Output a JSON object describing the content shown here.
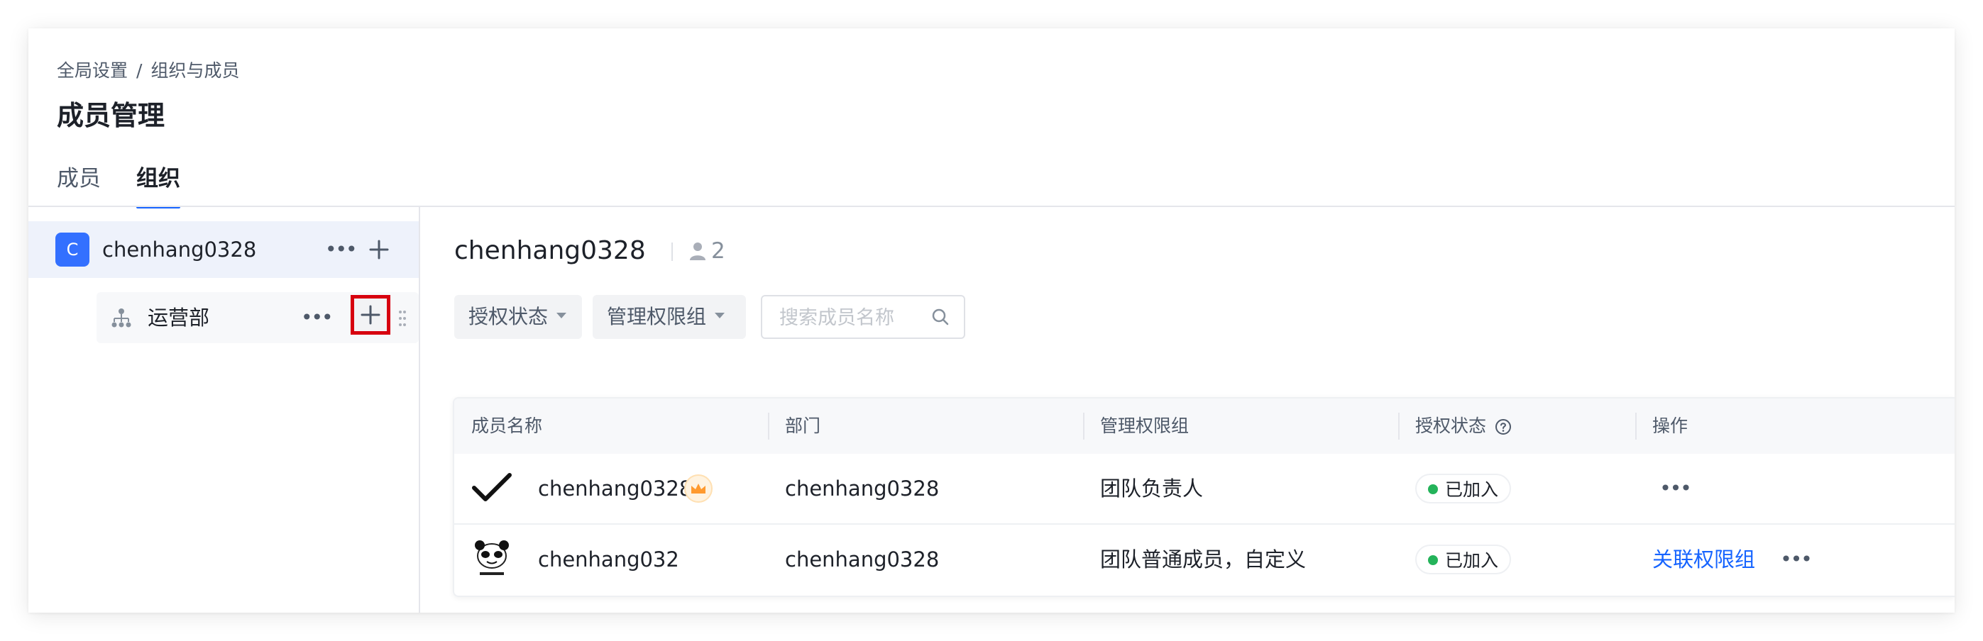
{
  "breadcrumb": {
    "root": "全局设置",
    "separator": "/",
    "current": "组织与成员"
  },
  "page_title": "成员管理",
  "tabs": [
    {
      "label": "成员",
      "active": false
    },
    {
      "label": "组织",
      "active": true
    }
  ],
  "sidebar": {
    "root": {
      "avatar_letter": "C",
      "name": "chenhang0328",
      "more_icon": "ellipsis-icon",
      "add_icon": "plus-icon"
    },
    "children": [
      {
        "name": "运营部",
        "icon": "org-structure-icon",
        "more_icon": "ellipsis-icon",
        "add_icon": "plus-icon"
      }
    ]
  },
  "main": {
    "org_name": "chenhang0328",
    "member_count": "2",
    "filters": {
      "auth_status": "授权状态",
      "permission_group": "管理权限组"
    },
    "search": {
      "placeholder": "搜索成员名称",
      "value": ""
    },
    "table": {
      "headers": {
        "name": "成员名称",
        "department": "部门",
        "permission_group": "管理权限组",
        "status": "授权状态",
        "actions": "操作"
      },
      "rows": [
        {
          "name": "chenhang0328",
          "avatar": "checkmark-avatar",
          "is_owner": true,
          "department": "chenhang0328",
          "permission_group": "团队负责人",
          "status": "已加入",
          "action_link": ""
        },
        {
          "name": "chenhang032",
          "avatar": "panda-meme-avatar",
          "is_owner": false,
          "department": "chenhang0328",
          "permission_group": "团队普通成员，自定义",
          "status": "已加入",
          "action_link": "关联权限组"
        }
      ]
    }
  },
  "colors": {
    "accent": "#1664ff",
    "highlight_border": "#d7000f",
    "status_joined": "#24b35a",
    "avatar_bg": "#3370ff"
  }
}
